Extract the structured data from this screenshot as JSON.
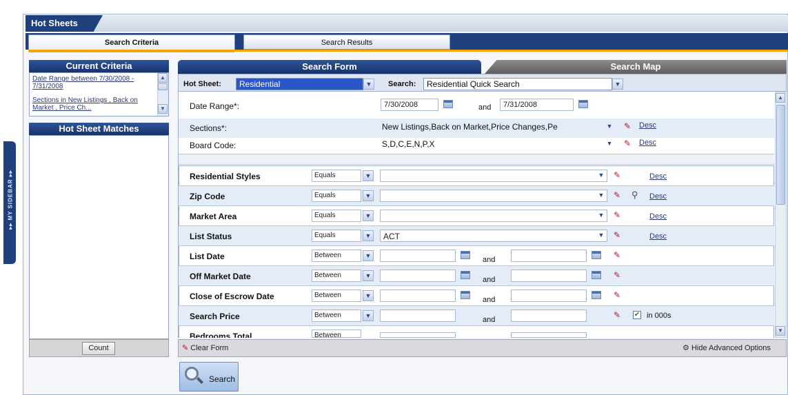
{
  "app": {
    "title": "Hot Sheets",
    "sidebar_label": "▸▸ MY SIDEBAR ▸▸"
  },
  "tabs": [
    {
      "label": "Search Criteria"
    },
    {
      "label": "Search Results"
    }
  ],
  "left": {
    "current_criteria_title": "Current Criteria",
    "criteria": [
      "Date Range between 7/30/2008 - 7/31/2008",
      "Sections in New Listings , Back on Market , Price Ch..."
    ],
    "matches_title": "Hot Sheet Matches",
    "count_label": "Count"
  },
  "right_tabs": {
    "form": "Search Form",
    "map": "Search Map"
  },
  "hotsheet_bar": {
    "hot_sheet_label": "Hot Sheet:",
    "hot_sheet_value": "Residential",
    "search_label": "Search:",
    "search_value": "Residential Quick Search"
  },
  "top_fields": [
    {
      "label": "Date Range*:",
      "from": "7/30/2008",
      "and": "and",
      "to": "7/31/2008"
    },
    {
      "label": "Sections*:",
      "value": "New Listings,Back on Market,Price Changes,Pe",
      "desc": "Desc"
    },
    {
      "label": "Board Code:",
      "value": "S,D,C,E,N,P,X",
      "desc": "Desc"
    }
  ],
  "rows": [
    {
      "label": "Residential Styles",
      "op": "Equals",
      "value": "",
      "desc": "Desc"
    },
    {
      "label": "Zip Code",
      "op": "Equals",
      "value": "",
      "desc": "Desc"
    },
    {
      "label": "Market Area",
      "op": "Equals",
      "value": "",
      "desc": "Desc"
    },
    {
      "label": "List Status",
      "op": "Equals",
      "value": "ACT",
      "desc": "Desc"
    },
    {
      "label": "List Date",
      "op": "Between",
      "and": "and"
    },
    {
      "label": "Off Market Date",
      "op": "Between",
      "and": "and"
    },
    {
      "label": "Close of Escrow Date",
      "op": "Between",
      "and": "and"
    },
    {
      "label": "Search Price",
      "op": "Between",
      "and": "and",
      "checkbox_label": "in 000s"
    },
    {
      "label": "Bedrooms Total",
      "op": "Between"
    }
  ],
  "bottom": {
    "clear_form": "Clear Form",
    "hide_advanced": "Hide Advanced Options",
    "search": "Search"
  }
}
